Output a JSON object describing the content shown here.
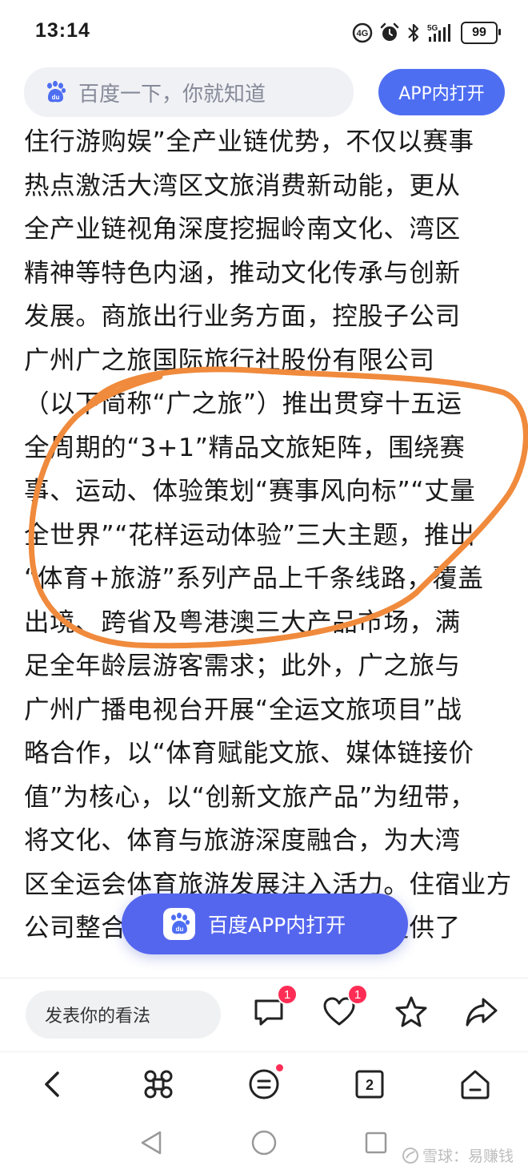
{
  "status_bar": {
    "time": "13:14",
    "signal_label": "5G",
    "battery": "99"
  },
  "header": {
    "search_placeholder": "百度一下，你就知道",
    "app_button": "APP内打开"
  },
  "article": {
    "lines": [
      "住行游购娱”全产业链优势，不仅以赛事",
      "热点激活大湾区文旅消费新动能，更从",
      "全产业链视角深度挖掘岭南文化、湾区",
      "精神等特色内涵，推动文化传承与创新",
      "发展。商旅出行业务方面，控股子公司",
      "广州广之旅国际旅行社股份有限公司",
      "（以下简称“广之旅”）推出贯穿十五运",
      "全周期的“3+1”精品文旅矩阵，围绕赛",
      "事、运动、体验策划“赛事风向标”“丈量",
      "全世界”“花样运动体验”三大主题，推出",
      "“体育+旅游”系列产品上千条线路，覆盖",
      "出境、跨省及粤港澳三大产品市场，满",
      "足全年龄层游客需求；此外，广之旅与",
      "广州广播电视台开展“全运文旅项目”战",
      "略合作，以“体育赋能文旅、媒体链接价",
      "值”为核心，以“创新文旅产品”为纽带，",
      "将文化、体育与旅游深度融合，为大湾",
      "区全运会体育旅游发展注入活力。住宿业方面，",
      "公司整合旗下酒店资源为全运会提供了"
    ]
  },
  "floating_button": {
    "label": "百度APP内打开"
  },
  "comment_bar": {
    "placeholder": "发表你的看法",
    "comment_count": "1",
    "like_count": "1"
  },
  "browser_nav": {
    "tab_count": "2"
  },
  "watermark": {
    "text": "雪球：易赚钱"
  },
  "colors": {
    "accent": "#4e6ef2",
    "badge": "#ff2d55",
    "annotation_stroke": "#f08a3c"
  }
}
